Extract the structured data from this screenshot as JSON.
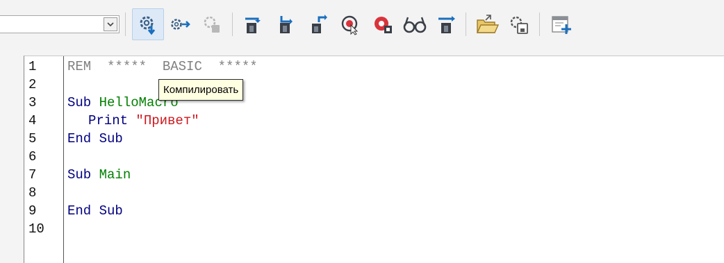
{
  "toolbar": {
    "module_selector": {
      "value": ""
    },
    "tooltip": "Компилировать"
  },
  "editor": {
    "line_numbers": [
      "1",
      "2",
      "3",
      "4",
      "5",
      "6",
      "7",
      "8",
      "9",
      "10"
    ],
    "line1": {
      "kw": "REM",
      "comment": "  *****  BASIC  *****"
    },
    "line3": {
      "kw": "Sub",
      "name": "HelloMacro"
    },
    "line4": {
      "kw": "Print",
      "str": "\"Привет\""
    },
    "line5": {
      "kw": "End Sub"
    },
    "line7": {
      "kw": "Sub",
      "name": "Main"
    },
    "line9": {
      "kw": "End Sub"
    }
  },
  "colors": {
    "keyword": "#000080",
    "identifier": "#008000",
    "string": "#ce181e",
    "comment": "#808080",
    "accent": "#1a6fbf"
  },
  "icons": [
    "chevron-down-icon",
    "compile-icon",
    "run-icon",
    "stop-icon",
    "step-over-icon",
    "step-into-icon",
    "step-out-icon",
    "breakpoint-icon",
    "manage-breakpoints-icon",
    "watch-icon",
    "object-catalog-icon",
    "open-folder-icon",
    "save-source-icon",
    "insert-source-icon"
  ]
}
